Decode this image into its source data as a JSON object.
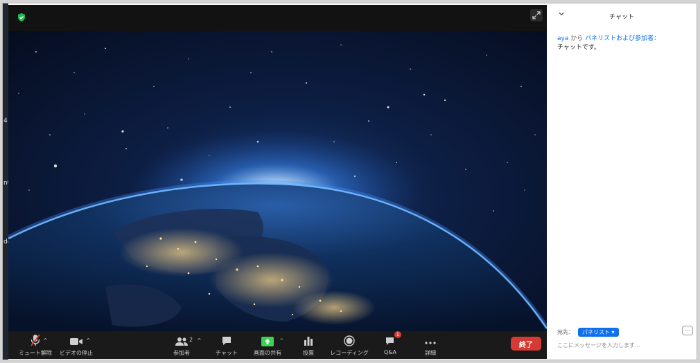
{
  "background_window": {
    "fragments": [
      "4",
      "nt",
      "de"
    ]
  },
  "video": {
    "security_icon": "green-shield-icon",
    "expand_icon": "expand-arrows-icon"
  },
  "toolbar": {
    "mute": {
      "label": "ミュート解除",
      "caret": "^"
    },
    "video": {
      "label": "ビデオの停止",
      "caret": "^"
    },
    "participants": {
      "label": "参加者",
      "count": "2",
      "caret": "^"
    },
    "chat": {
      "label": "チャット"
    },
    "share": {
      "label": "画面の共有",
      "caret": "^"
    },
    "polling": {
      "label": "投票"
    },
    "record": {
      "label": "レコーディング"
    },
    "qa": {
      "label": "Q&A",
      "badge": "1"
    },
    "more": {
      "label": "詳細"
    },
    "end": {
      "label": "終了"
    }
  },
  "chat": {
    "title": "チャット",
    "messages": [
      {
        "sender": "aya",
        "from_text": " から ",
        "recipient": "パネリストおよび参加者：",
        "text": "チャットです。"
      }
    ],
    "to_label": "宛先：",
    "to_value": "パネリスト ▾",
    "more_label": "···",
    "input_placeholder": "ここにメッセージを入力します..."
  },
  "colors": {
    "accent_blue": "#0e71eb",
    "share_green": "#3ad353",
    "end_red": "#d63a34",
    "toolbar_bg": "#1a1a1a"
  }
}
